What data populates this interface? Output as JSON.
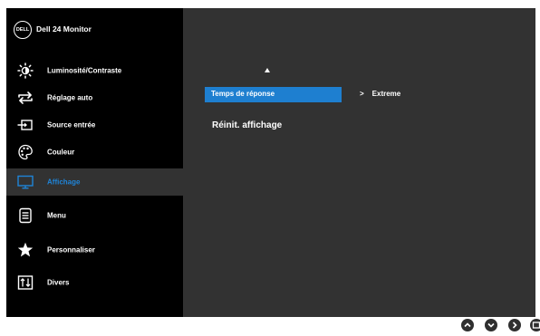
{
  "header": {
    "logo_text": "DELL",
    "title": "Dell 24 Monitor"
  },
  "sidebar": {
    "items": [
      {
        "label": "Luminosité/Contraste",
        "icon": "brightness-icon"
      },
      {
        "label": "Réglage auto",
        "icon": "auto-adjust-icon"
      },
      {
        "label": "Source entrée",
        "icon": "input-source-icon"
      },
      {
        "label": "Couleur",
        "icon": "color-palette-icon"
      },
      {
        "label": "Affichage",
        "icon": "display-icon",
        "active": true
      },
      {
        "label": "Menu",
        "icon": "menu-icon"
      },
      {
        "label": "Personnaliser",
        "icon": "star-icon"
      },
      {
        "label": "Divers",
        "icon": "others-icon"
      }
    ]
  },
  "content": {
    "selected_label": "Temps de réponse",
    "selected_value_marker": ">",
    "selected_value": "Extreme",
    "second_label": "Réinit. affichage"
  },
  "colors": {
    "accent": "#1f84d8",
    "panel": "#323232",
    "sidebar": "#000000"
  },
  "nav_buttons": [
    "chevron-up-icon",
    "chevron-down-icon",
    "chevron-right-icon",
    "exit-icon"
  ]
}
